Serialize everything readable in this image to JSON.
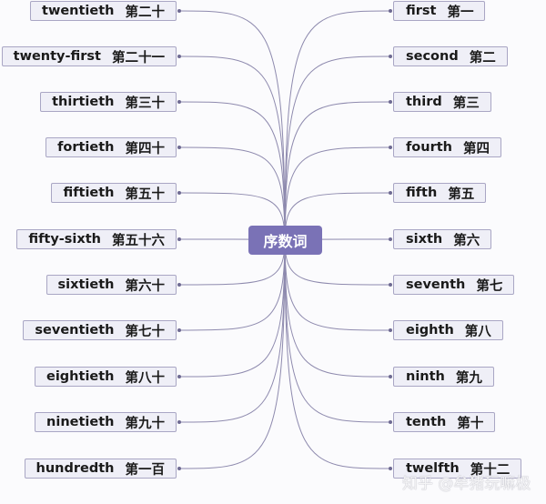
{
  "title": "序数词",
  "left_nodes": [
    {
      "en": "twentieth",
      "zh": "第二十"
    },
    {
      "en": "twenty-first",
      "zh": "第二十一"
    },
    {
      "en": "thirtieth",
      "zh": "第三十"
    },
    {
      "en": "fortieth",
      "zh": "第四十"
    },
    {
      "en": "fiftieth",
      "zh": "第五十"
    },
    {
      "en": "fifty-sixth",
      "zh": "第五十六"
    },
    {
      "en": "sixtieth",
      "zh": "第六十"
    },
    {
      "en": "seventieth",
      "zh": "第七十"
    },
    {
      "en": "eightieth",
      "zh": "第八十"
    },
    {
      "en": "ninetieth",
      "zh": "第九十"
    },
    {
      "en": "hundredth",
      "zh": "第一百"
    }
  ],
  "right_nodes": [
    {
      "en": "first",
      "zh": "第一"
    },
    {
      "en": "second",
      "zh": "第二"
    },
    {
      "en": "third",
      "zh": "第三"
    },
    {
      "en": "fourth",
      "zh": "第四"
    },
    {
      "en": "fifth",
      "zh": "第五"
    },
    {
      "en": "sixth",
      "zh": "第六"
    },
    {
      "en": "seventh",
      "zh": "第七"
    },
    {
      "en": "eighth",
      "zh": "第八"
    },
    {
      "en": "ninth",
      "zh": "第九"
    },
    {
      "en": "tenth",
      "zh": "第十"
    },
    {
      "en": "twelfth",
      "zh": "第十二"
    }
  ],
  "watermark": "知乎 @牟猪玩嘛极",
  "colors": {
    "root_fill": "#7a72b6",
    "node_fill": "#efeff7",
    "node_border": "#a9a6c4",
    "link": "#8e8aae"
  }
}
